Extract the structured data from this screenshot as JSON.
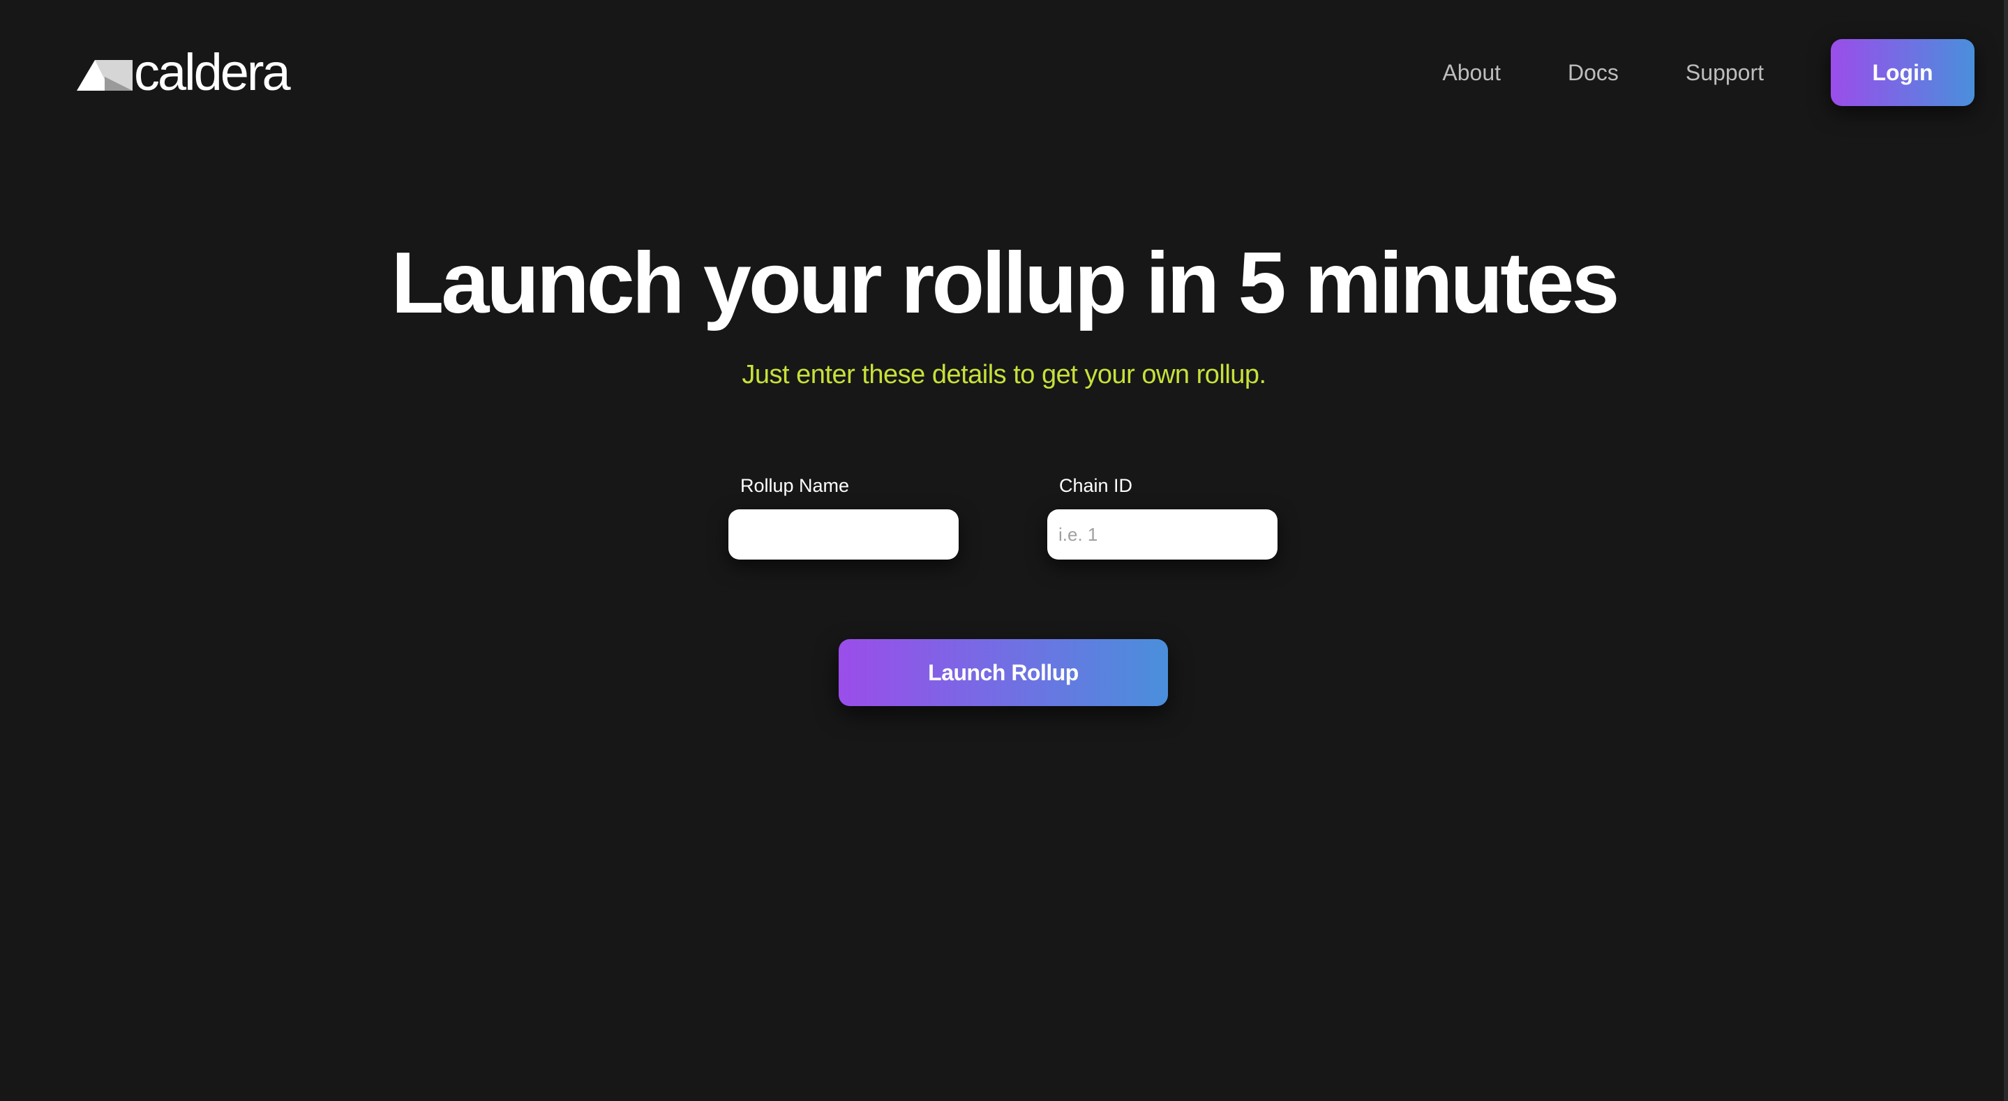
{
  "header": {
    "logo_text": "caldera",
    "logo_icon": "mountain-logo-icon",
    "nav": [
      {
        "label": "About"
      },
      {
        "label": "Docs"
      },
      {
        "label": "Support"
      }
    ],
    "login_label": "Login"
  },
  "hero": {
    "title": "Launch your rollup in 5 minutes",
    "subtitle": "Just enter these details to get your own rollup."
  },
  "form": {
    "rollup_name": {
      "label": "Rollup Name",
      "value": "",
      "placeholder": ""
    },
    "chain_id": {
      "label": "Chain ID",
      "value": "",
      "placeholder": "i.e. 1"
    },
    "submit_label": "Launch Rollup"
  },
  "colors": {
    "background": "#171717",
    "subtitle_accent": "#c8e03a",
    "gradient_start": "#9b4dea",
    "gradient_end": "#4a8fdc"
  }
}
